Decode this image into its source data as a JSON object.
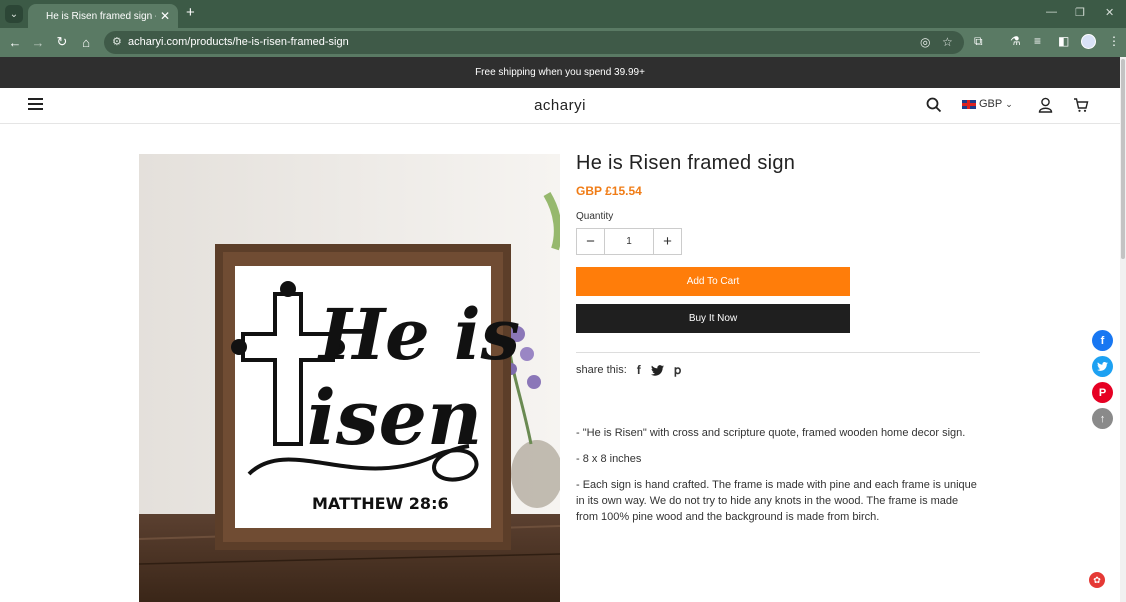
{
  "browser": {
    "tab_title": "He is Risen framed sign - achar",
    "url": "acharyi.com/products/he-is-risen-framed-sign"
  },
  "announcement": "Free shipping when you spend 39.99+",
  "header": {
    "brand": "acharyi",
    "currency": "GBP"
  },
  "product": {
    "title": "He is Risen framed sign",
    "price": "GBP £15.54",
    "quantity_label": "Quantity",
    "quantity": "1",
    "add_to_cart": "Add To Cart",
    "buy_now": "Buy It Now",
    "share_label": "share this:",
    "image_text": {
      "line1": "He is",
      "line2": "isen",
      "verse": "MATTHEW 28:6"
    },
    "description": [
      "- \"He is Risen\" with cross and scripture quote, framed wooden home decor sign.",
      "-  8 x 8 inches",
      "- Each sign is hand crafted. The frame is made with pine and each frame is unique in its own way. We do not try to hide any knots in the wood. The frame is made from 100% pine wood and the background is made from birch."
    ]
  },
  "colors": {
    "accent": "#ff7d0a",
    "price": "#f07c16",
    "dark": "#1f1f1f",
    "facebook": "#1877f2",
    "twitter": "#1da1f2",
    "pinterest": "#e60023"
  }
}
